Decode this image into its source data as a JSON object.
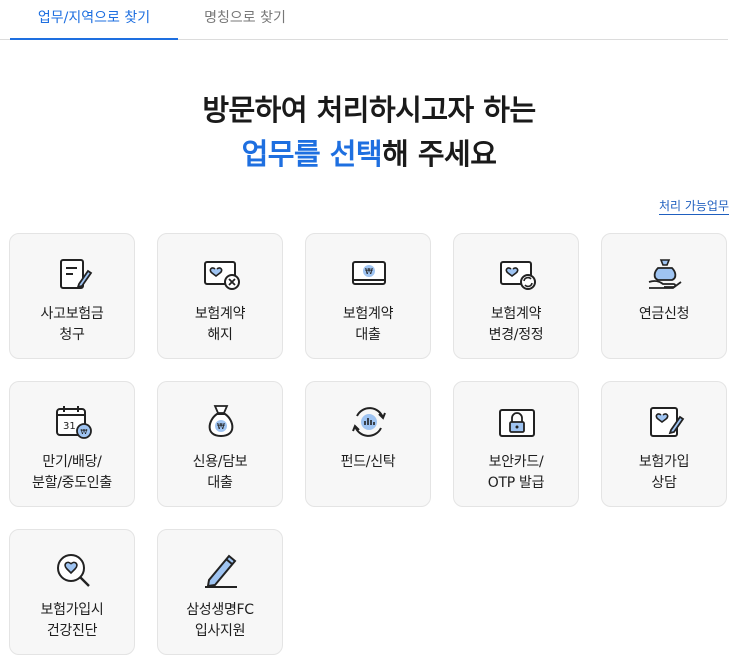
{
  "tabs": {
    "active": "업무/지역으로 찾기",
    "inactive": "명칭으로 찾기"
  },
  "headline": {
    "line1": "방문하여 처리하시고자 하는",
    "line2_highlight": "업무를 선택",
    "line2_rest": "해 주세요"
  },
  "link_label": "처리 가능업무",
  "colors": {
    "accent": "#1e6fe0",
    "icon_fill": "#9fc4f2",
    "card_bg": "#f7f7f7"
  },
  "cards": [
    {
      "label": "사고보험금\n청구",
      "icon": "claim-document-icon"
    },
    {
      "label": "보험계약\n해지",
      "icon": "contract-cancel-icon"
    },
    {
      "label": "보험계약\n대출",
      "icon": "contract-loan-icon"
    },
    {
      "label": "보험계약\n변경/정정",
      "icon": "contract-change-icon"
    },
    {
      "label": "연금신청",
      "icon": "pension-money-bag-icon"
    },
    {
      "label": "만기/배당/\n분할/중도인출",
      "icon": "calendar-coin-icon"
    },
    {
      "label": "신용/담보\n대출",
      "icon": "money-bag-icon"
    },
    {
      "label": "펀드/신탁",
      "icon": "fund-chart-icon"
    },
    {
      "label": "보안카드/\nOTP 발급",
      "icon": "security-lock-icon"
    },
    {
      "label": "보험가입\n상담",
      "icon": "consult-heart-pen-icon"
    },
    {
      "label": "보험가입시\n건강진단",
      "icon": "health-check-magnifier-icon"
    },
    {
      "label": "삼성생명FC\n입사지원",
      "icon": "fc-apply-pen-icon"
    }
  ]
}
